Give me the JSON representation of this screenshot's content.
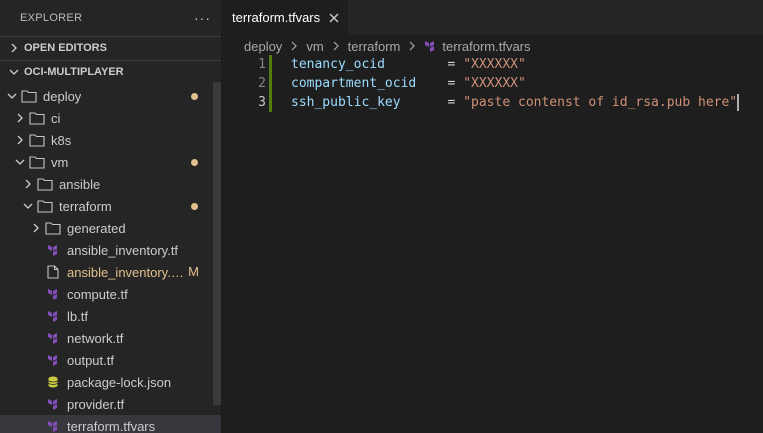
{
  "sidebar": {
    "title": "EXPLORER",
    "more_icon": "ellipsis-icon",
    "sections": {
      "open_editors": "OPEN EDITORS",
      "workspace": "OCI-MULTIPLAYER"
    },
    "tree": [
      {
        "label": "deploy",
        "type": "folder",
        "open": true,
        "status": "dot"
      },
      {
        "label": "ci",
        "type": "folder",
        "open": false
      },
      {
        "label": "k8s",
        "type": "folder",
        "open": false
      },
      {
        "label": "vm",
        "type": "folder",
        "open": true,
        "status": "dot"
      },
      {
        "label": "ansible",
        "type": "folder",
        "open": false
      },
      {
        "label": "terraform",
        "type": "folder",
        "open": true,
        "status": "dot"
      },
      {
        "label": "generated",
        "type": "folder",
        "open": false
      },
      {
        "label": "ansible_inventory.tf",
        "type": "terraform-file"
      },
      {
        "label": "ansible_inventory.tf.tpl",
        "type": "file",
        "status": "M"
      },
      {
        "label": "compute.tf",
        "type": "terraform-file"
      },
      {
        "label": "lb.tf",
        "type": "terraform-file"
      },
      {
        "label": "network.tf",
        "type": "terraform-file"
      },
      {
        "label": "output.tf",
        "type": "terraform-file"
      },
      {
        "label": "package-lock.json",
        "type": "json-file"
      },
      {
        "label": "provider.tf",
        "type": "terraform-file"
      },
      {
        "label": "terraform.tfvars",
        "type": "terraform-file",
        "selected": true
      }
    ]
  },
  "editor": {
    "tab": {
      "label": "terraform.tfvars"
    },
    "breadcrumb": [
      "deploy",
      "vm",
      "terraform",
      "terraform.tfvars"
    ],
    "lines": [
      {
        "num": "1",
        "key": "tenancy_ocid        ",
        "eq": "= ",
        "value": "\"XXXXXX\""
      },
      {
        "num": "2",
        "key": "compartment_ocid    ",
        "eq": "= ",
        "value": "\"XXXXXX\""
      },
      {
        "num": "3",
        "key": "ssh_public_key      ",
        "eq": "= ",
        "value": "\"paste contenst of id_rsa.pub here\""
      }
    ]
  },
  "colors": {
    "modified": "#e2c08d",
    "terraform_icon": "#844fba",
    "json_icon": "#cbcb41",
    "added_gutter": "#587c0c",
    "string": "#ce9178",
    "key": "#9cdcfe"
  }
}
